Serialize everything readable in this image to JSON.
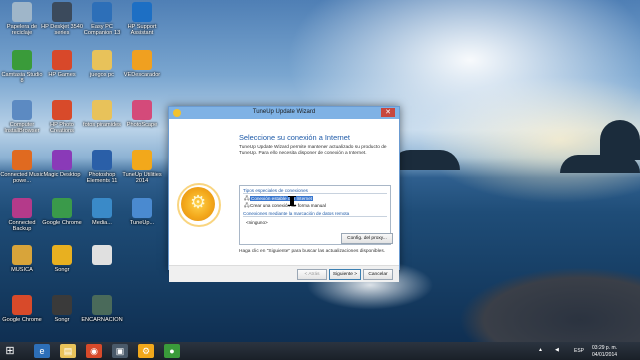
{
  "desktop": {
    "icons": [
      {
        "label": "Papelera de reciclaje",
        "icon": "recycle-bin-icon",
        "color": "#9fb6c9"
      },
      {
        "label": "HP Deskjet 3540 series",
        "icon": "printer-icon",
        "color": "#3b4a5c"
      },
      {
        "label": "Easy PC Companion 13",
        "icon": "phone-icon",
        "color": "#2d6fb8"
      },
      {
        "label": "HP Support Assistant",
        "icon": "hp-support-icon",
        "color": "#1d6fc4"
      },
      {
        "label": "Camtasia Studio 8",
        "icon": "camtasia-icon",
        "color": "#3a9b3a"
      },
      {
        "label": "HP Games",
        "icon": "hp-games-icon",
        "color": "#d8482a"
      },
      {
        "label": "juegos pc",
        "icon": "folder-icon",
        "color": "#e8c25a"
      },
      {
        "label": "VEDescarador",
        "icon": "download-icon",
        "color": "#f0a020"
      },
      {
        "label": "Computer InstallBrowser",
        "icon": "computer-icon",
        "color": "#5c8ac2"
      },
      {
        "label": "HP Photo Creations",
        "icon": "photo-creations-icon",
        "color": "#d84a2a"
      },
      {
        "label": "fotos piramides",
        "icon": "folder-icon",
        "color": "#e8c25a"
      },
      {
        "label": "PhotoScape",
        "icon": "photoscape-icon",
        "color": "#d44a7a"
      },
      {
        "label": "Connected Music powe...",
        "icon": "music-icon",
        "color": "#e06a20"
      },
      {
        "label": "Magic Desktop",
        "icon": "magic-desktop-icon",
        "color": "#8a3ab8"
      },
      {
        "label": "Photoshop Elements 11",
        "icon": "photoshop-icon",
        "color": "#2a5fa8"
      },
      {
        "label": "TuneUp Utilities 2014",
        "icon": "tuneup-icon",
        "color": "#f2a81b"
      },
      {
        "label": "Connected Backup",
        "icon": "backup-icon",
        "color": "#b43a8a"
      },
      {
        "label": "Google Chrome",
        "icon": "chrome-icon",
        "color": "#3a9a4a"
      },
      {
        "label": "Media...",
        "icon": "media-icon",
        "color": "#3a8ac8"
      },
      {
        "label": "TuneUp...",
        "icon": "tuneup-icon",
        "color": "#4a8ad0"
      },
      {
        "label": "MUSICA",
        "icon": "music-folder-icon",
        "color": "#d8a43a"
      },
      {
        "label": "Songr",
        "icon": "songr-icon",
        "color": "#e8b020"
      },
      {
        "label": "",
        "icon": "document-icon",
        "color": "#e0e0e0"
      },
      {
        "label": "Google Chrome",
        "icon": "chrome-icon",
        "color": "#d84a2a"
      },
      {
        "label": "Songr",
        "icon": "songr-icon",
        "color": "#3a3a3a"
      },
      {
        "label": "ENCARNACION",
        "icon": "folder-icon",
        "color": "#4a6a5a"
      }
    ]
  },
  "window": {
    "title": "TuneUp Update Wizard",
    "heading": "Seleccione su conexión a Internet",
    "description": "TuneUp Update Wizard permite mantener actualizado su producto de TuneUp. Para ello necesita disponer de conexión a Internet.",
    "group1_label": "Tipos especiales de conexiones",
    "option_selected": "Conexión estable con Internet",
    "option_manual": "Crear una conexión de forma manual",
    "group2_label": "Conexiones mediante la marcación de datos remota",
    "option_none": "<ninguno>",
    "proxy_button": "Config. del proxy...",
    "hint": "Haga clic en \"Siguiente\" para buscar las actualizaciones disponibles.",
    "back_button": "< Atrás",
    "next_button": "Siguiente >",
    "cancel_button": "Cancelar"
  },
  "taskbar": {
    "start_icon": "windows-start-icon",
    "language": "ESP",
    "time": "03:29 p. m.",
    "date": "04/01/2014"
  },
  "colors": {
    "accent": "#1e5aa8",
    "selection": "#3a78d0",
    "titlebar": "#7fb2e5",
    "close": "#c7473e"
  }
}
